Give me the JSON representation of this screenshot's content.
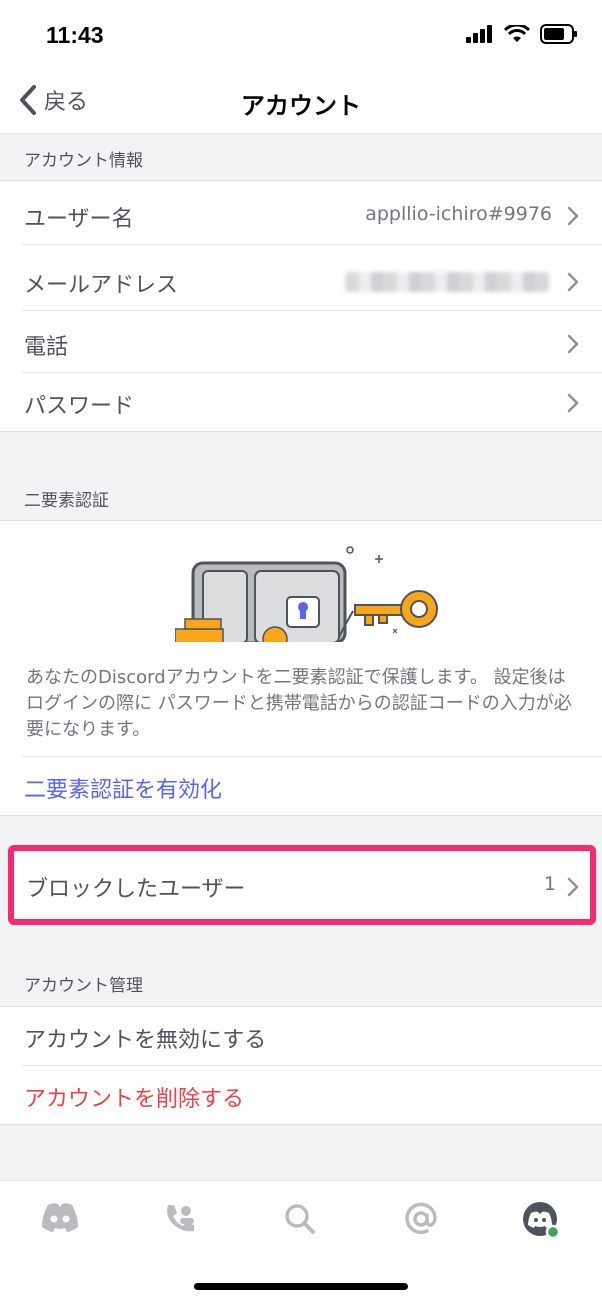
{
  "status_bar": {
    "time": "11:43"
  },
  "nav": {
    "back_label": "戻る",
    "title": "アカウント"
  },
  "account_info": {
    "header": "アカウント情報",
    "rows": [
      {
        "label": "ユーザー名",
        "value": "appllio-ichiro#9976"
      },
      {
        "label": "メールアドレス",
        "value": ""
      },
      {
        "label": "電話",
        "value": ""
      },
      {
        "label": "パスワード",
        "value": ""
      }
    ]
  },
  "two_factor": {
    "header": "二要素認証",
    "description": "あなたのDiscordアカウントを二要素認証で保護します。 設定後はログインの際に パスワードと携帯電話からの認証コードの入力が必要になります。",
    "enable_link": "二要素認証を有効化"
  },
  "blocked": {
    "label": "ブロックしたユーザー",
    "count": "1",
    "highlight_color": "#f72a6e"
  },
  "account_management": {
    "header": "アカウント管理",
    "disable_label": "アカウントを無効にする",
    "delete_label": "アカウントを削除する"
  },
  "tabs": [
    "discord-home-icon",
    "friends-icon",
    "search-icon",
    "mentions-icon",
    "profile-avatar-icon"
  ],
  "colors": {
    "link": "#5865f2",
    "danger": "#ed4245",
    "online": "#3ba55d"
  }
}
